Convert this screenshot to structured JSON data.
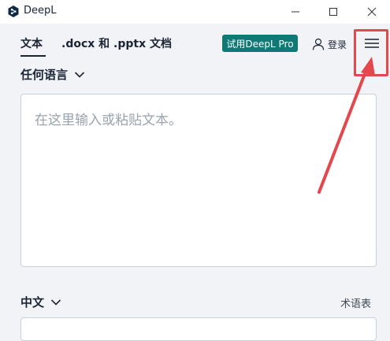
{
  "window": {
    "title": "DeepL",
    "controls": [
      "minimize",
      "maximize",
      "close"
    ]
  },
  "header": {
    "tabs": [
      {
        "label": "文本",
        "active": true
      },
      {
        "label": ".docx 和 .pptx 文档",
        "active": false
      }
    ],
    "pro_button_label": "试用DeepL Pro",
    "login_label": "登录",
    "menu_icon": "hamburger-menu-icon"
  },
  "source": {
    "language_label": "任何语言",
    "placeholder": "在这里输入或粘贴文本。"
  },
  "target": {
    "language_label": "中文",
    "glossary_label": "术语表"
  },
  "colors": {
    "accent": "#0f7a75",
    "highlight": "#e2484d",
    "background": "#f1f3f7"
  }
}
